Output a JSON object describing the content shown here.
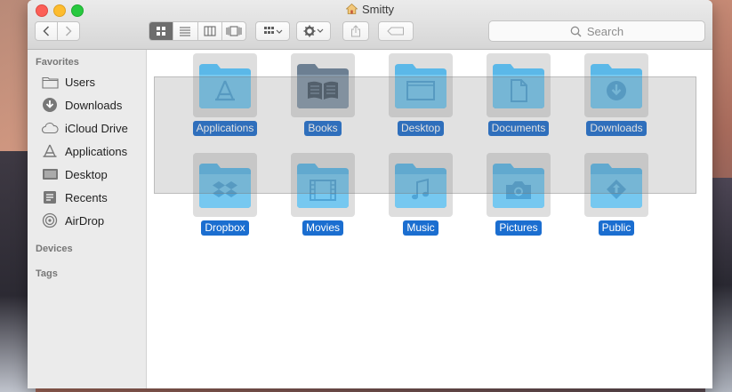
{
  "window": {
    "title": "Smitty",
    "title_icon": "home-icon"
  },
  "toolbar": {
    "back_icon": "chevron-left-icon",
    "forward_icon": "chevron-right-icon",
    "view_modes": [
      "icon-view",
      "list-view",
      "column-view",
      "cover-flow-view"
    ],
    "active_view": "icon-view",
    "arrange_icon": "arrange-grid-icon",
    "action_icon": "gear-icon",
    "share_icon": "share-icon",
    "tag_icon": "tag-icon",
    "search_placeholder": "Search"
  },
  "sidebar": {
    "favorites_heading": "Favorites",
    "favorites": [
      {
        "label": "Users",
        "icon": "folder-icon"
      },
      {
        "label": "Downloads",
        "icon": "download-circle-icon"
      },
      {
        "label": "iCloud Drive",
        "icon": "cloud-icon"
      },
      {
        "label": "Applications",
        "icon": "applications-icon"
      },
      {
        "label": "Desktop",
        "icon": "desktop-icon"
      },
      {
        "label": "Recents",
        "icon": "recents-icon"
      },
      {
        "label": "AirDrop",
        "icon": "airdrop-icon"
      }
    ],
    "devices_heading": "Devices",
    "tags_heading": "Tags"
  },
  "content": {
    "items": [
      {
        "label": "Applications",
        "glyph": "applications-glyph",
        "kind": "folder"
      },
      {
        "label": "Books",
        "glyph": "book-glyph",
        "kind": "grey-folder"
      },
      {
        "label": "Desktop",
        "glyph": "desktop-glyph",
        "kind": "folder"
      },
      {
        "label": "Documents",
        "glyph": "document-glyph",
        "kind": "folder"
      },
      {
        "label": "Downloads",
        "glyph": "download-glyph",
        "kind": "folder"
      },
      {
        "label": "Dropbox",
        "glyph": "dropbox-glyph",
        "kind": "folder"
      },
      {
        "label": "Movies",
        "glyph": "film-glyph",
        "kind": "folder"
      },
      {
        "label": "Music",
        "glyph": "music-note-glyph",
        "kind": "folder"
      },
      {
        "label": "Pictures",
        "glyph": "camera-glyph",
        "kind": "folder"
      },
      {
        "label": "Public",
        "glyph": "public-glyph",
        "kind": "folder"
      }
    ],
    "selection_color": "#1b6ed0",
    "folder_color": "#6ec6f0"
  }
}
